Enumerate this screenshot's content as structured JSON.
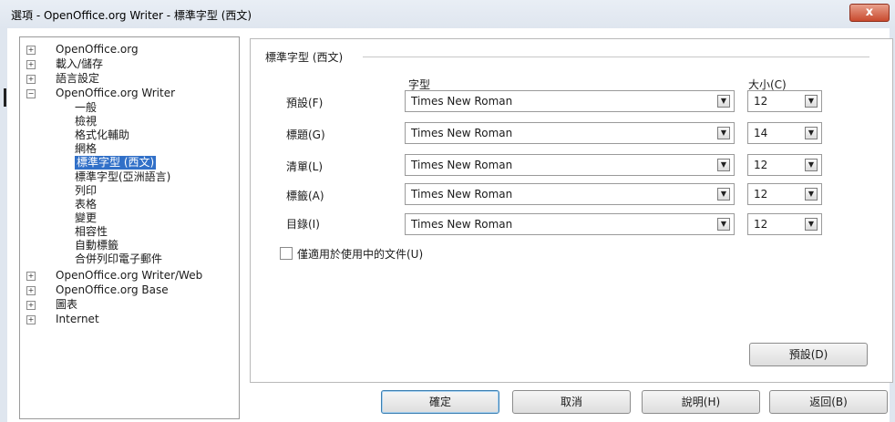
{
  "window": {
    "title": "選項 - OpenOffice.org Writer - 標準字型 (西文)",
    "close_label": "x"
  },
  "tree": [
    {
      "label": "OpenOffice.org",
      "expander": "+"
    },
    {
      "label": "載入/儲存",
      "expander": "+"
    },
    {
      "label": "語言設定",
      "expander": "+"
    },
    {
      "label": "OpenOffice.org Writer",
      "expander": "−"
    },
    {
      "label": "一般"
    },
    {
      "label": "檢視"
    },
    {
      "label": "格式化輔助"
    },
    {
      "label": "網格"
    },
    {
      "label": "標準字型 (西文)",
      "selected": true
    },
    {
      "label": "標準字型(亞洲語言)"
    },
    {
      "label": "列印"
    },
    {
      "label": "表格"
    },
    {
      "label": "變更"
    },
    {
      "label": "相容性"
    },
    {
      "label": "自動標籤"
    },
    {
      "label": "合併列印電子郵件"
    },
    {
      "label": "OpenOffice.org Writer/Web",
      "expander": "+"
    },
    {
      "label": "OpenOffice.org Base",
      "expander": "+"
    },
    {
      "label": "圖表",
      "expander": "+"
    },
    {
      "label": "Internet",
      "expander": "+"
    }
  ],
  "panel": {
    "group_title": "標準字型 (西文)",
    "col_font": "字型",
    "col_size": "大小(C)",
    "rows": [
      {
        "label": "預設(F)",
        "font": "Times New Roman",
        "size": "12"
      },
      {
        "label": "標題(G)",
        "font": "Times New Roman",
        "size": "14"
      },
      {
        "label": "清單(L)",
        "font": "Times New Roman",
        "size": "12"
      },
      {
        "label": "標籤(A)",
        "font": "Times New Roman",
        "size": "12"
      },
      {
        "label": "目錄(I)",
        "font": "Times New Roman",
        "size": "12"
      }
    ],
    "checkbox_label": "僅適用於使用中的文件(U)",
    "checkbox_checked": false,
    "default_button": "預設(D)"
  },
  "footer": {
    "ok": "確定",
    "cancel": "取消",
    "help": "說明(H)",
    "back": "返回(B)"
  },
  "icons": {
    "expander": "expander-icon",
    "dropdown": "dropdown-arrow-icon"
  }
}
